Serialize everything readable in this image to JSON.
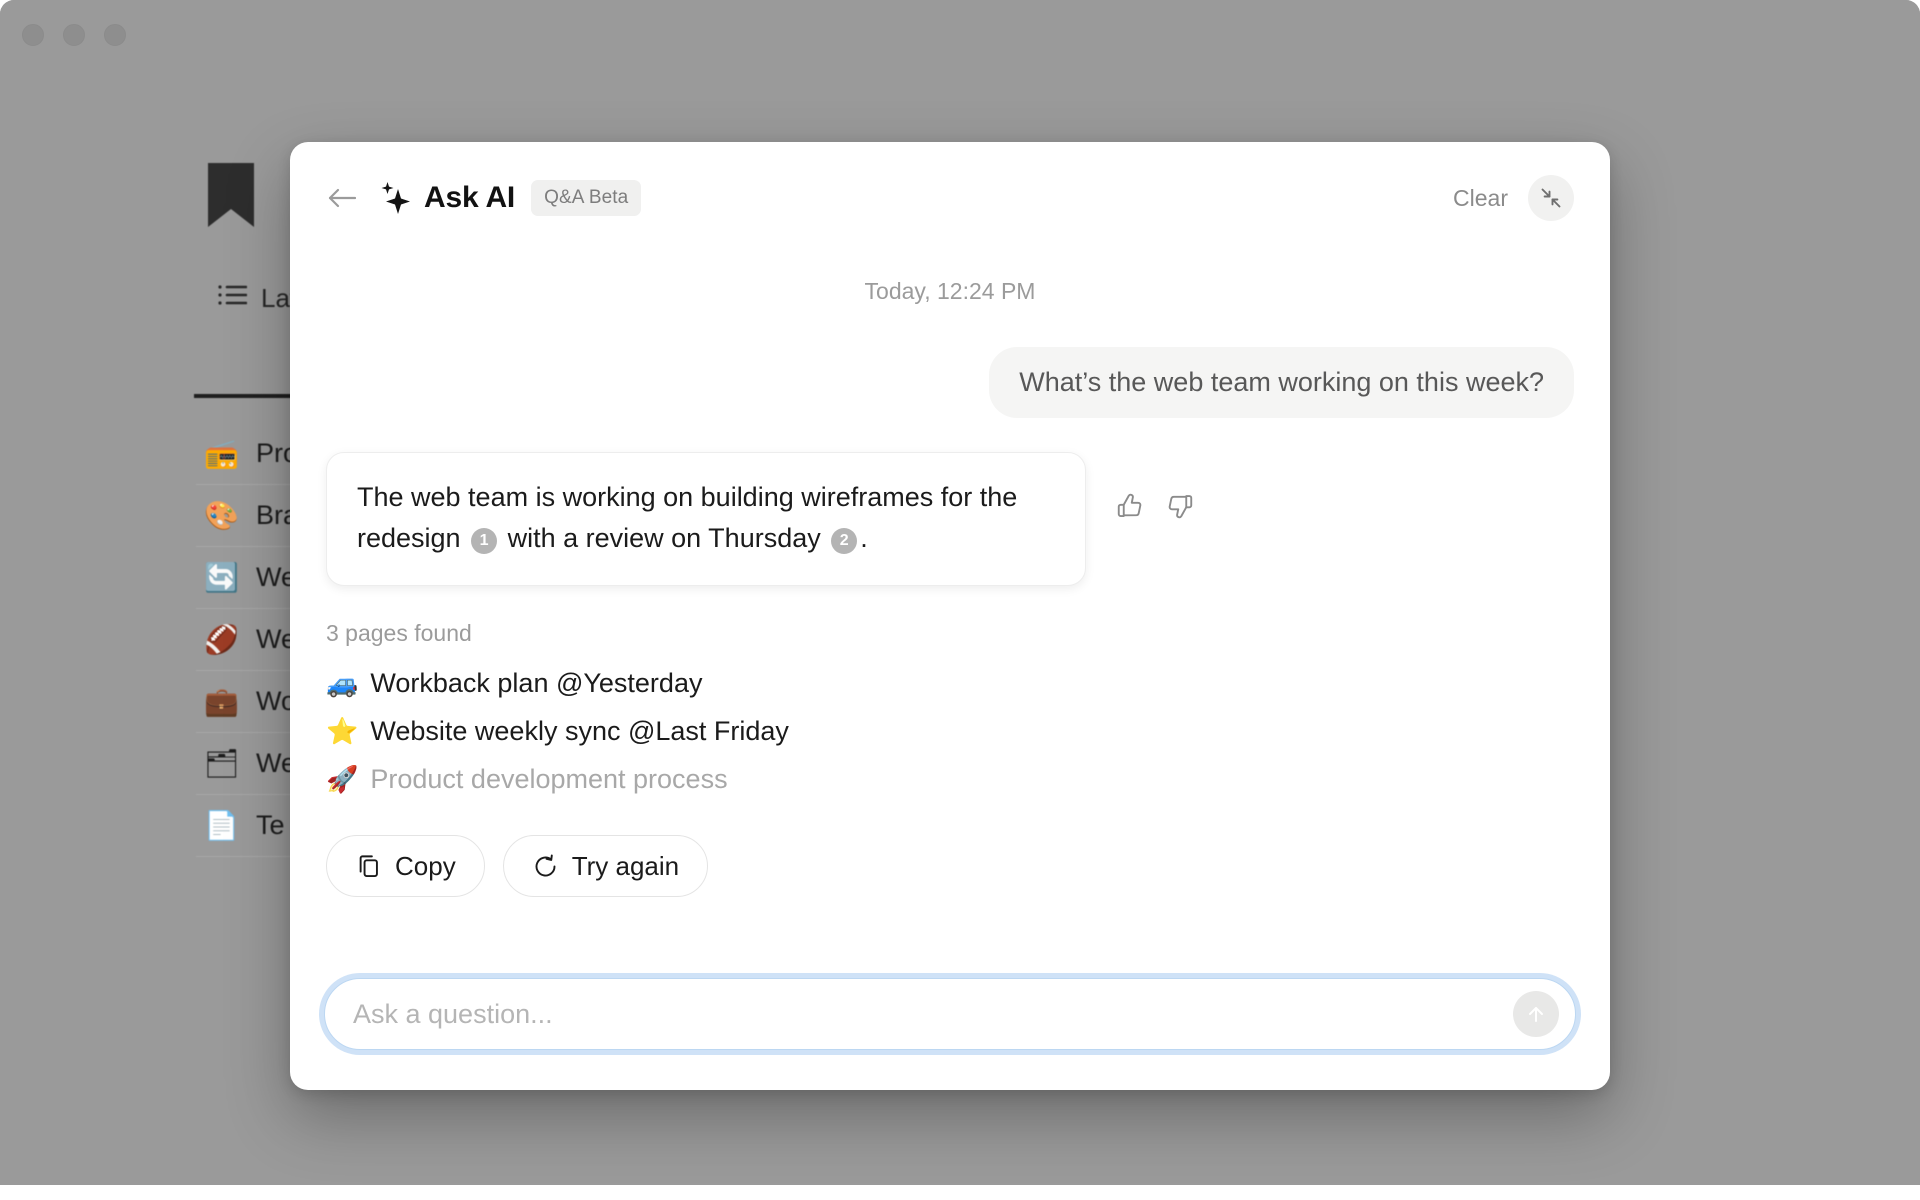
{
  "window": {
    "traffic_lights": [
      "close",
      "minimize",
      "zoom"
    ]
  },
  "background_app": {
    "logo_icon": "bookmark-icon",
    "tab": {
      "icon": "list-icon",
      "label": "Lat"
    },
    "list_items": [
      {
        "emoji": "📻",
        "label": "Pro",
        "icon_name": "radio-emoji"
      },
      {
        "emoji": "🎨",
        "label": "Bra",
        "icon_name": "palette-emoji"
      },
      {
        "emoji": "🔄",
        "label": "We",
        "icon_name": "counterclockwise-arrow-emoji"
      },
      {
        "emoji": "🏈",
        "label": "We",
        "icon_name": "football-emoji"
      },
      {
        "emoji": "💼",
        "label": "Wo",
        "icon_name": "briefcase-emoji"
      },
      {
        "emoji": "🗂",
        "label": "We",
        "icon_name": "window-emoji"
      },
      {
        "emoji": "📄",
        "label": "Te",
        "icon_name": "document-emoji"
      }
    ]
  },
  "modal": {
    "header": {
      "back_icon": "arrow-left-icon",
      "sparkle_icon": "sparkle-icon",
      "title": "Ask AI",
      "badge": "Q&A Beta",
      "clear_label": "Clear",
      "collapse_icon": "collapse-diagonal-icon"
    },
    "conversation": {
      "timestamp": "Today, 12:24 PM",
      "user_message": "What’s the web team working on this week?",
      "answer": {
        "part1": "The web team is working on building wireframes for the redesign ",
        "citation1": "1",
        "part2": " with a review on Thursday ",
        "citation2": "2",
        "part3": "."
      },
      "feedback": {
        "thumbs_up_icon": "thumbs-up-icon",
        "thumbs_down_icon": "thumbs-down-icon"
      }
    },
    "sources": {
      "label": "3 pages found",
      "items": [
        {
          "emoji": "🚙",
          "icon_name": "car-emoji",
          "text": "Workback plan @Yesterday",
          "dimmed": false
        },
        {
          "emoji": "⭐",
          "icon_name": "star-emoji",
          "text": "Website weekly sync @Last Friday",
          "dimmed": false
        },
        {
          "emoji": "🚀",
          "icon_name": "rocket-emoji",
          "text": "Product development process",
          "dimmed": true
        }
      ]
    },
    "actions": [
      {
        "icon": "copy-icon",
        "label": "Copy"
      },
      {
        "icon": "refresh-icon",
        "label": "Try again"
      }
    ],
    "input": {
      "placeholder": "Ask a question...",
      "value": "",
      "send_icon": "arrow-up-icon"
    }
  },
  "colors": {
    "desktop_gray": "#9a9a9a",
    "modal_bg": "#ffffff",
    "user_bubble_bg": "#f5f5f4",
    "badge_bg": "#f0f0ef",
    "muted_text": "#9b9b9b",
    "citation_bg": "#b4b4b4",
    "focus_ring": "#82b4eb"
  }
}
